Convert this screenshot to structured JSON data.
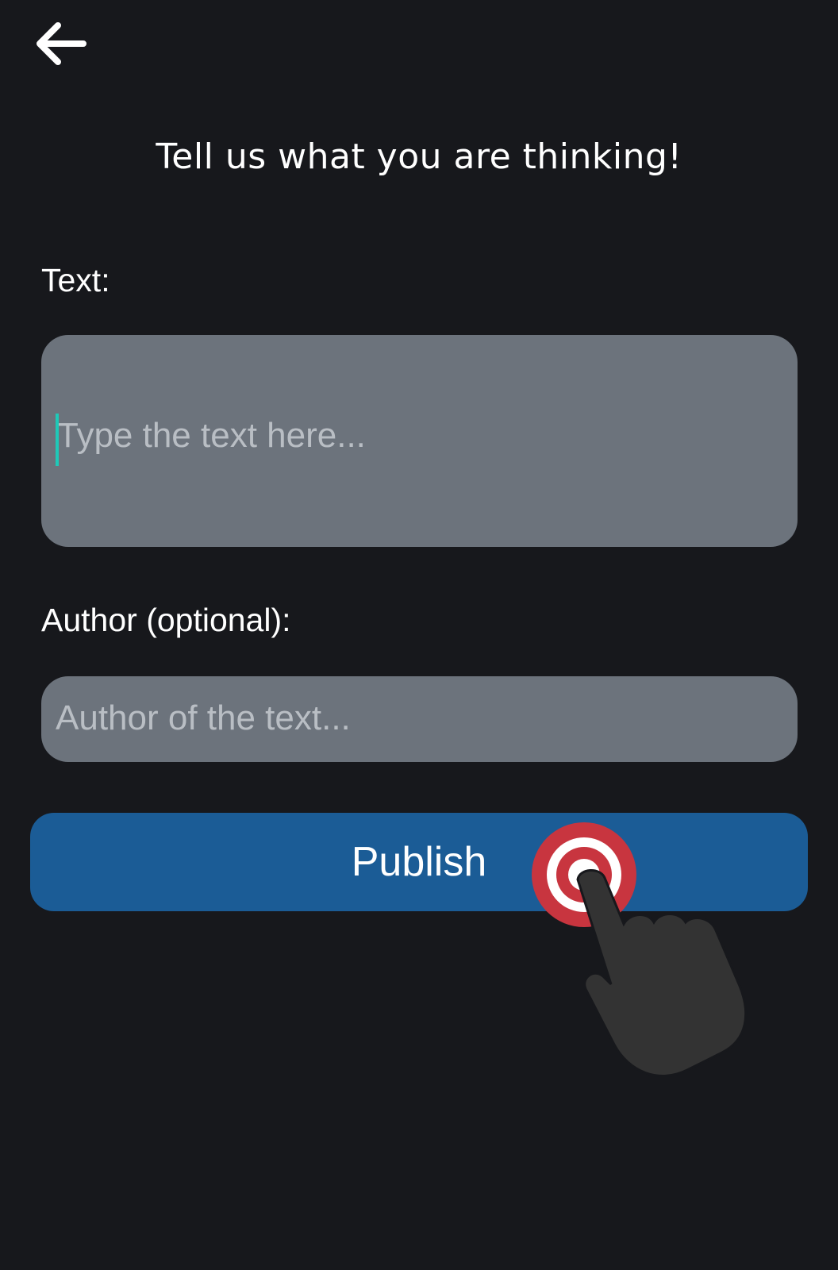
{
  "header": {
    "back_icon": "arrow-left-icon",
    "title": "Tell us what you are thinking!"
  },
  "form": {
    "text_label": "Text:",
    "text_placeholder": "Type the text here...",
    "text_value": "",
    "author_label": "Author (optional):",
    "author_placeholder": "Author of the text...",
    "author_value": "",
    "publish_label": "Publish"
  },
  "overlay": {
    "tap_icon": "tap-gesture-hand-icon"
  },
  "colors": {
    "background": "#17181c",
    "input_background": "#6c737c",
    "placeholder_text": "#b9bec4",
    "caret": "#1ec9b8",
    "primary_button": "#1b5c96",
    "tap_target": "#c8353f",
    "hand": "#333333"
  }
}
